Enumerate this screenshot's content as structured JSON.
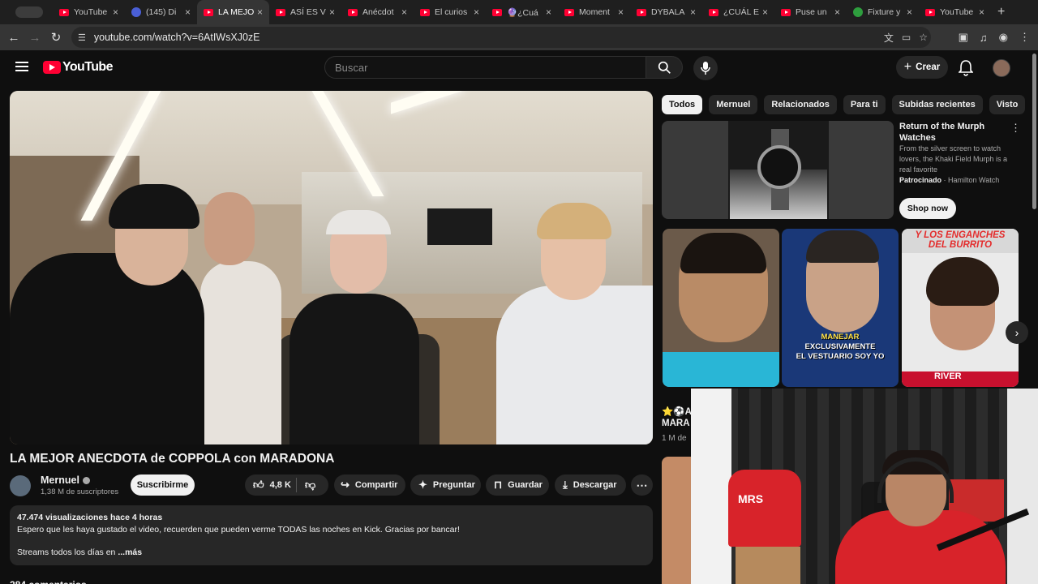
{
  "browser": {
    "tabs": [
      {
        "label": "YouTube",
        "icon": "youtube-icon",
        "active": false
      },
      {
        "label": "(145) Di",
        "icon": "badge-icon",
        "active": false
      },
      {
        "label": "LA MEJO",
        "icon": "youtube-icon",
        "active": true
      },
      {
        "label": "ASÍ ES V",
        "icon": "youtube-icon",
        "active": false
      },
      {
        "label": "Anécdot",
        "icon": "youtube-icon",
        "active": false
      },
      {
        "label": "El curios",
        "icon": "youtube-icon",
        "active": false
      },
      {
        "label": "🔮¿Cuá",
        "icon": "youtube-icon",
        "active": false
      },
      {
        "label": "Moment",
        "icon": "youtube-icon",
        "active": false
      },
      {
        "label": "DYBALA",
        "icon": "youtube-icon",
        "active": false
      },
      {
        "label": "¿CUÁL E",
        "icon": "youtube-icon",
        "active": false
      },
      {
        "label": "Puse un",
        "icon": "youtube-icon",
        "active": false
      },
      {
        "label": "Fixture y",
        "icon": "globe-icon",
        "active": false
      },
      {
        "label": "YouTube",
        "icon": "youtube-icon",
        "active": false
      }
    ],
    "url": "youtube.com/watch?v=6AtIWsXJ0zE"
  },
  "header": {
    "logo_text": "YouTube",
    "search_placeholder": "Buscar",
    "create_label": "Crear"
  },
  "video": {
    "title": "LA MEJOR ANECDOTA de COPPOLA con MARADONA",
    "channel_name": "Mernuel",
    "subscribers": "1,38 M de suscriptores",
    "subscribe_label": "Suscribirme",
    "likes": "4,8 K",
    "share_label": "Compartir",
    "ask_label": "Preguntar",
    "save_label": "Guardar",
    "download_label": "Descargar",
    "views_line": "47.474 visualizaciones  hace 4 horas",
    "desc_line1": "Espero que les haya gustado el video, recuerden que pueden verme TODAS las noches en Kick. Gracias por bancar!",
    "desc_line3": "Streams todos los días en",
    "more_label": "...más",
    "comments_cut": "284 comentarios"
  },
  "sidebar": {
    "chips": [
      "Todos",
      "Mernuel",
      "Relacionados",
      "Para ti",
      "Subidas recientes",
      "Visto"
    ],
    "ad": {
      "title": "Return of the Murph Watches",
      "description": "From the silver screen to watch lovers, the Khaki Field Murph is a real favorite",
      "sponsored": "Patrocinado",
      "advertiser": "Hamilton Watch",
      "cta": "Shop now"
    },
    "shorts": {
      "short2_caption_yellow": "MANEJAR",
      "short2_caption_line2": "EXCLUSIVAMENTE",
      "short2_caption_line3": "EL VESTUARIO SOY YO",
      "short3_top_line1": "Y LOS ENGANCHES",
      "short3_top_line2": "DEL BURRITO",
      "short3_bottom": "RIVER"
    },
    "next_item_title1": "⭐⚽AL",
    "next_item_title2": "MARA",
    "next_item_meta": "1 M de",
    "webcam_jersey_text": "MRS"
  }
}
